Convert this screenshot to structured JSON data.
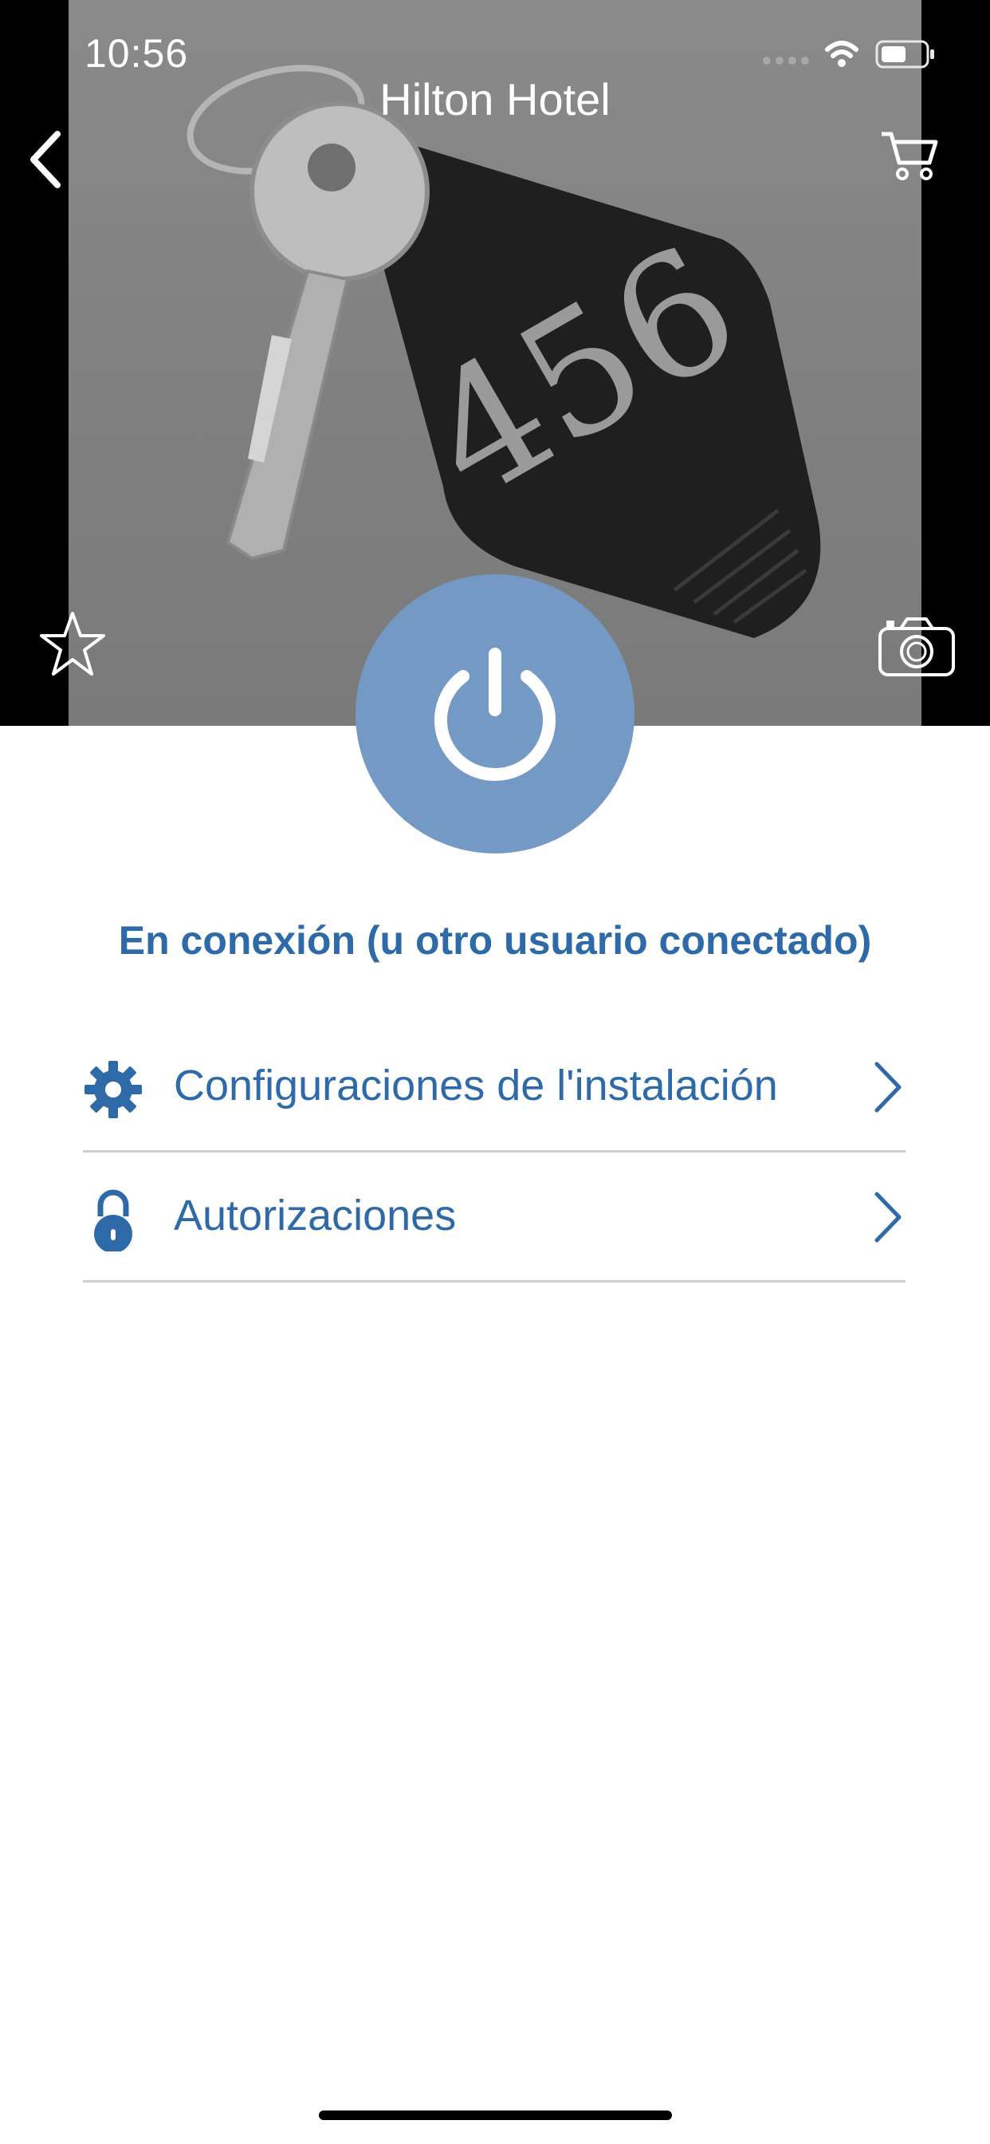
{
  "status_bar": {
    "time": "10:56"
  },
  "header": {
    "title": "Hilton Hotel"
  },
  "hero": {
    "tag_number": "456"
  },
  "connection": {
    "status": "En conexión (u otro usuario conectado)"
  },
  "menu": {
    "items": [
      {
        "label": "Configuraciones de l'instalación",
        "icon": "gear-icon"
      },
      {
        "label": "Autorizaciones",
        "icon": "lock-icon"
      }
    ]
  },
  "colors": {
    "accent": "#2f6aa8",
    "power_button": "#7399c4",
    "divider": "#cfcfcf"
  }
}
